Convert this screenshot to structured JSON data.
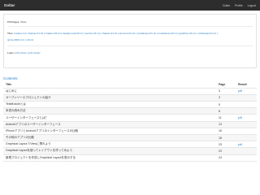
{
  "navbar": {
    "brand": "Gvitar",
    "links": [
      "Guide",
      "Profile",
      "Logout"
    ]
  },
  "info": {
    "pdf_pages_label": "Pdf Pages:",
    "pdf_pages_value": "31/ky",
    "files_label": "Tiles:",
    "files_line1": "preface.txt | chapter-01.txt | chapter-02.txt | background-02.txt | section-01.txt | chapter-01.txt | element-01.txt | mediaview-01.txt | mediaview-02.txt | graphics-01.txt | mobileapp-01.txt |",
    "files_line2": "sprite-0001.txt | s-01.txt",
    "login_label": "Login:",
    "login_links": [
      "pdf reduce",
      "pdf render"
    ]
  },
  "contents": {
    "title": "Contents",
    "headers": {
      "title": "Title",
      "page": "Page",
      "result": "Result"
    },
    "rows": [
      {
        "title": "はじめに",
        "page": "3",
        "result": "pdf",
        "level": 1
      },
      {
        "title": "オープンソースプロジェクトの紹介",
        "page": "3",
        "result": "",
        "level": 2
      },
      {
        "title": "TestModuleとは",
        "page": "5",
        "result": "",
        "level": 2
      },
      {
        "title": "本書の読み方法",
        "page": "8",
        "result": "",
        "level": 2
      },
      {
        "title": "ユーザーインターフェースとは？",
        "page": "11",
        "result": "pdf",
        "level": 1
      },
      {
        "title": "Androidアプリのユーザーインターフェース",
        "page": "13",
        "result": "",
        "level": 2
      },
      {
        "title": "iPhoneアプリとAndroidアプリのインターフェースの比較",
        "page": "16",
        "result": "",
        "level": 2
      },
      {
        "title": "その他のアプリの比較",
        "page": "18",
        "result": "",
        "level": 3
      },
      {
        "title": "Graphical Layout T/Viewに慣れよう",
        "page": "23",
        "result": "pdf",
        "level": 1
      },
      {
        "title": "Graphical Layoutを使ってレイアウトを作ってみよう",
        "page": "23",
        "result": "",
        "level": 2
      },
      {
        "title": "新規プロジェクトを作成しGraphical Layoutを表示する",
        "page": "24",
        "result": "",
        "level": 3
      }
    ]
  }
}
